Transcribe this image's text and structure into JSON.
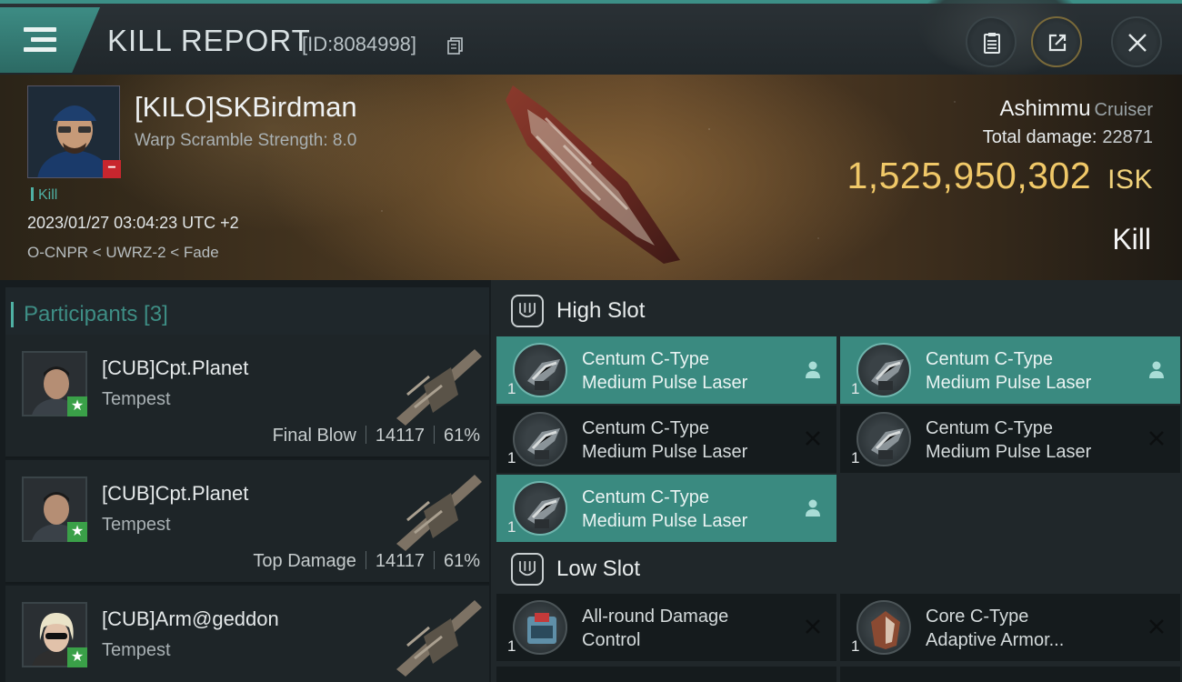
{
  "header": {
    "title": "KILL REPORT",
    "report_id": "[ID:8084998]"
  },
  "victim": {
    "name": "[KILO]SKBirdman",
    "warp_scramble": "Warp Scramble Strength: 8.0",
    "kill_tag": "Kill",
    "datetime": "2023/01/27 03:04:23 UTC +2",
    "location": "O-CNPR < UWRZ-2 < Fade",
    "ship": "Ashimmu",
    "ship_class": "Cruiser",
    "total_damage_label": "Total damage:",
    "total_damage": "22871",
    "isk_value": "1,525,950,302",
    "isk_unit": "ISK",
    "result": "Kill"
  },
  "participants": {
    "title": "Participants [3]",
    "items": [
      {
        "name": "[CUB]Cpt.Planet",
        "ship": "Tempest",
        "role": "Final Blow",
        "damage": "14117",
        "percent": "61%"
      },
      {
        "name": "[CUB]Cpt.Planet",
        "ship": "Tempest",
        "role": "Top Damage",
        "damage": "14117",
        "percent": "61%"
      },
      {
        "name": "[CUB]Arm@geddon",
        "ship": "Tempest"
      }
    ]
  },
  "fittings": {
    "high_slot": {
      "title": "High Slot",
      "modules": [
        {
          "qty": "1",
          "line1": "Centum C-Type",
          "line2": "Medium Pulse Laser",
          "state": "dropped"
        },
        {
          "qty": "1",
          "line1": "Centum C-Type",
          "line2": "Medium Pulse Laser",
          "state": "dropped"
        },
        {
          "qty": "1",
          "line1": "Centum C-Type",
          "line2": "Medium Pulse Laser",
          "state": "destroyed"
        },
        {
          "qty": "1",
          "line1": "Centum C-Type",
          "line2": "Medium Pulse Laser",
          "state": "destroyed"
        },
        {
          "qty": "1",
          "line1": "Centum C-Type",
          "line2": "Medium Pulse Laser",
          "state": "dropped"
        }
      ]
    },
    "low_slot": {
      "title": "Low Slot",
      "modules": [
        {
          "qty": "1",
          "line1": "All-round Damage",
          "line2": "Control",
          "state": "destroyed"
        },
        {
          "qty": "1",
          "line1": "Core C-Type",
          "line2": "Adaptive Armor...",
          "state": "destroyed"
        }
      ]
    }
  },
  "colors": {
    "accent": "#3a8a80",
    "isk": "#f0c868",
    "loss_badge": "#c8262e",
    "star_badge": "#3aa048"
  },
  "icons": [
    "menu-icon",
    "copy-icon",
    "clipboard-icon",
    "share-icon",
    "close-icon",
    "high-slot-icon",
    "low-slot-icon",
    "pilot-icon",
    "destroyed-x-icon",
    "star-icon"
  ]
}
